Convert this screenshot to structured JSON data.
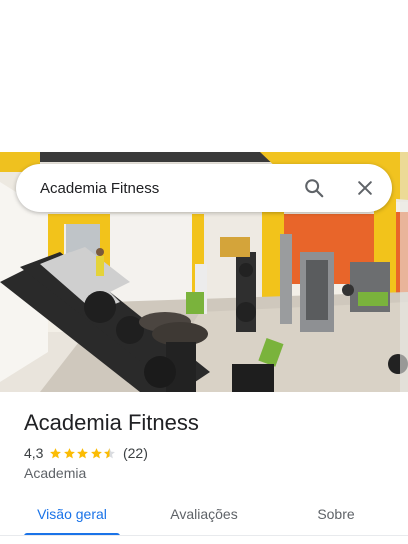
{
  "search": {
    "query": "Academia Fitness"
  },
  "photo": {
    "alt": "Academia Fitness"
  },
  "place": {
    "name": "Academia Fitness",
    "rating": "4,3",
    "stars": 4.5,
    "reviews": "(22)",
    "category": "Academia"
  },
  "tabs": [
    {
      "label": "Visão geral",
      "active": true
    },
    {
      "label": "Avaliações",
      "active": false
    },
    {
      "label": "Sobre",
      "active": false
    }
  ],
  "colors": {
    "accent": "#1a73e8",
    "star": "#fbbc04",
    "wall_yellow": "#f2c31b",
    "wall_orange": "#e8652a"
  }
}
